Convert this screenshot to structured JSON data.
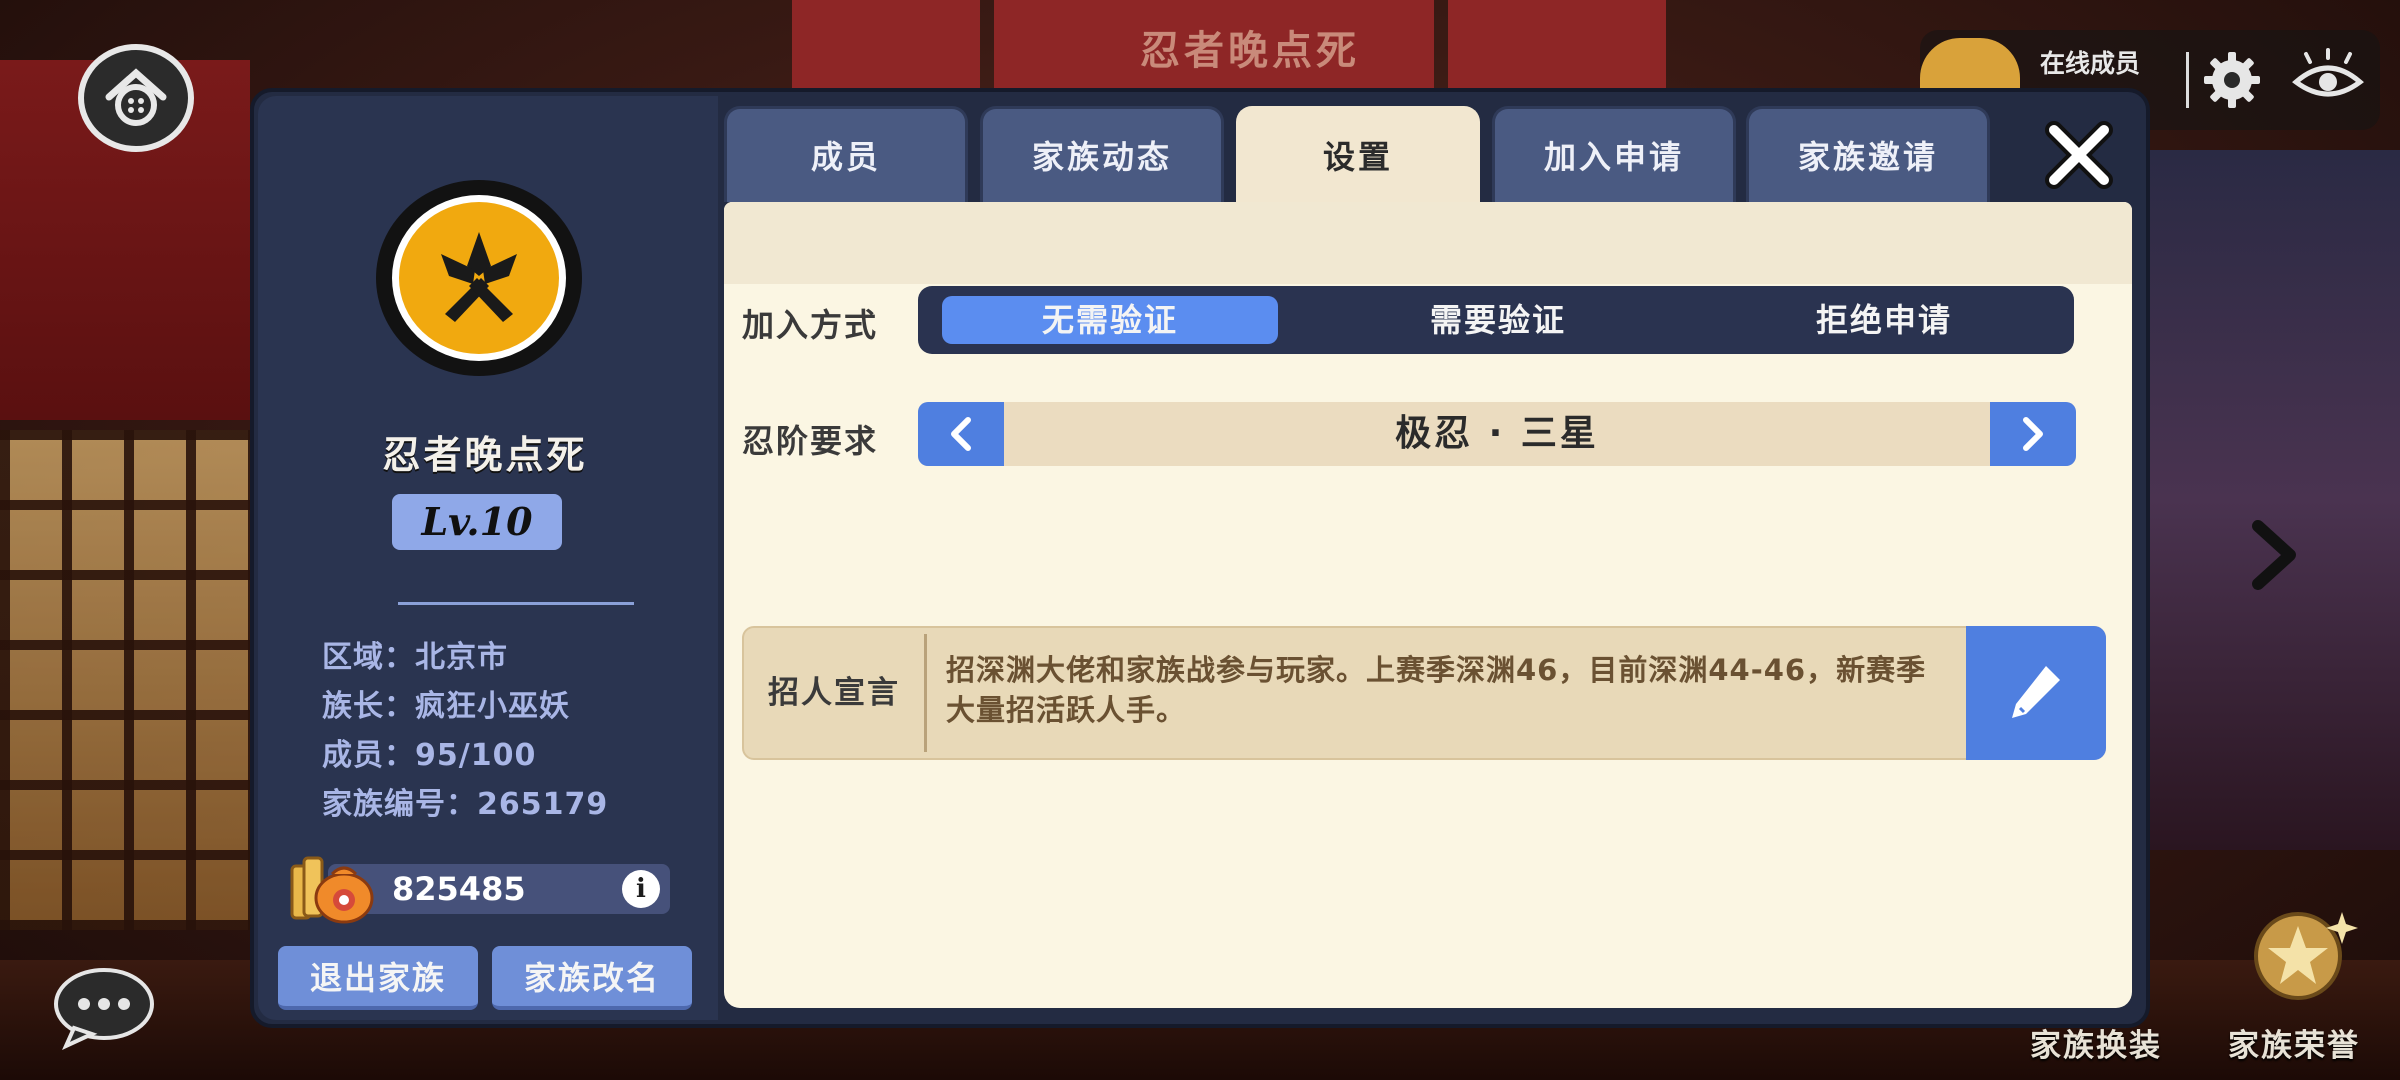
{
  "background": {
    "banner_title": "忍者晚点死"
  },
  "hud": {
    "online_label": "在线成员"
  },
  "family": {
    "name": "忍者晚点死",
    "level": "Lv.10",
    "info": [
      "区域：北京市",
      "族长：疯狂小巫妖",
      "成员：95/100",
      "家族编号：265179"
    ],
    "coins": "825485",
    "info_icon": "i",
    "quit_label": "退出家族",
    "rename_label": "家族改名"
  },
  "tabs": [
    {
      "label": "成员",
      "active": false
    },
    {
      "label": "家族动态",
      "active": false
    },
    {
      "label": "设置",
      "active": true
    },
    {
      "label": "加入申请",
      "active": false
    },
    {
      "label": "家族邀请",
      "active": false
    }
  ],
  "settings": {
    "join_mode_label": "加入方式",
    "join_options": [
      "无需验证",
      "需要验证",
      "拒绝申请"
    ],
    "join_selected": "无需验证",
    "rank_label": "忍阶要求",
    "rank_value": "极忍 · 三星",
    "manifesto_label": "招人宣言",
    "manifesto_text": "招深渊大佬和家族战参与玩家。上赛季深渊46，目前深渊44-46，新赛季大量招活跃人手。"
  },
  "bottom": {
    "costume_label": "家族换装",
    "honor_label": "家族荣誉"
  },
  "icons": {
    "home": "home-icon",
    "gear": "gear-icon",
    "eye": "eye-icon",
    "close": "close-icon",
    "edit": "pencil-icon",
    "chat": "chat-icon",
    "coin": "coin-bag-icon",
    "honor": "trophy-icon"
  },
  "colors": {
    "panel": "#232b42",
    "accent_blue": "#5b8df0",
    "content_bg": "#fbf6e3",
    "emblem_yellow": "#f1a90f"
  }
}
